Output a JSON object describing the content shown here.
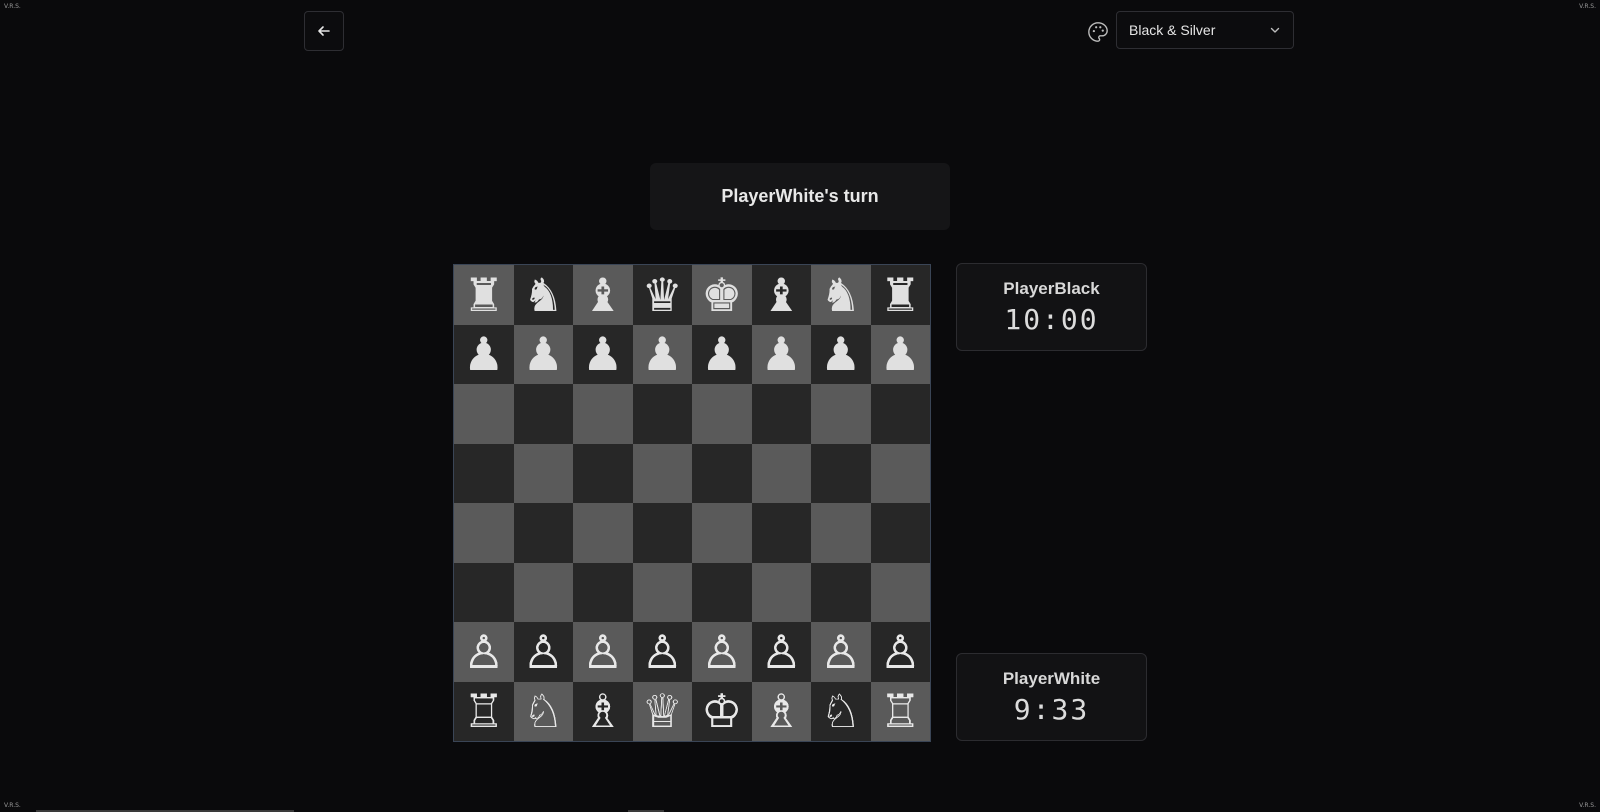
{
  "corners": {
    "tl": "V.R.S.",
    "tr": "V.R.S.",
    "bl": "V.R.S.",
    "br": "V.R.S."
  },
  "header": {
    "back_icon": "arrow-left-icon",
    "palette_icon": "palette-icon",
    "theme_select": {
      "value": "Black & Silver",
      "icon": "chevron-down-icon"
    }
  },
  "status": {
    "turn_text": "PlayerWhite's turn"
  },
  "players": {
    "black": {
      "name": "PlayerBlack",
      "clock": "10:00"
    },
    "white": {
      "name": "PlayerWhite",
      "clock": "9:33"
    }
  },
  "board": {
    "light_color": "#5a5a5a",
    "dark_color": "#272727",
    "ranks": [
      [
        "♜",
        "♞",
        "♝",
        "♛",
        "♚",
        "♝",
        "♞",
        "♜"
      ],
      [
        "♟",
        "♟",
        "♟",
        "♟",
        "♟",
        "♟",
        "♟",
        "♟"
      ],
      [
        "",
        "",
        "",
        "",
        "",
        "",
        "",
        ""
      ],
      [
        "",
        "",
        "",
        "",
        "",
        "",
        "",
        ""
      ],
      [
        "",
        "",
        "",
        "",
        "",
        "",
        "",
        ""
      ],
      [
        "",
        "",
        "",
        "",
        "",
        "",
        "",
        ""
      ],
      [
        "♙",
        "♙",
        "♙",
        "♙",
        "♙",
        "♙",
        "♙",
        "♙"
      ],
      [
        "♖",
        "♘",
        "♗",
        "♕",
        "♔",
        "♗",
        "♘",
        "♖"
      ]
    ]
  }
}
